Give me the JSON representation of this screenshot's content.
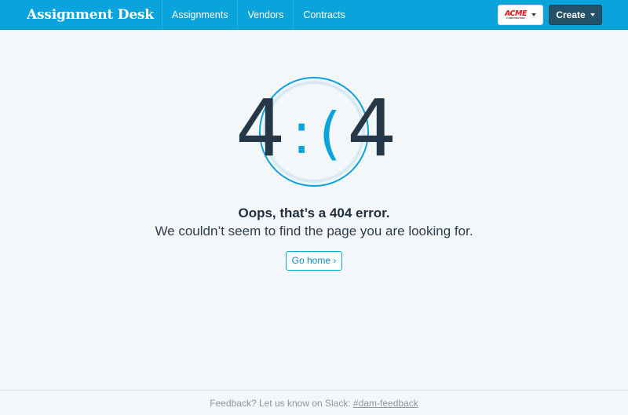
{
  "header": {
    "brand": "Assignment Desk",
    "nav": [
      "Assignments",
      "Vendors",
      "Contracts"
    ],
    "org_logo_text": "ACME",
    "org_logo_subtext": "CORPORATION",
    "create_label": "Create"
  },
  "graphic": {
    "left_digit": "4",
    "face": ":(",
    "right_digit": "4"
  },
  "message": {
    "title": "Oops, that’s a 404 error.",
    "subtitle": "We couldn’t seem to find the page you are looking for.",
    "home_button": "Go home ›"
  },
  "footer": {
    "text": "Feedback? Let us know on Slack: ",
    "link": "#dam-feedback"
  },
  "colors": {
    "navbar": "#0aa3dc",
    "create_button": "#25506a",
    "background": "#f4f7fa",
    "accent": "#0aa3dc"
  }
}
